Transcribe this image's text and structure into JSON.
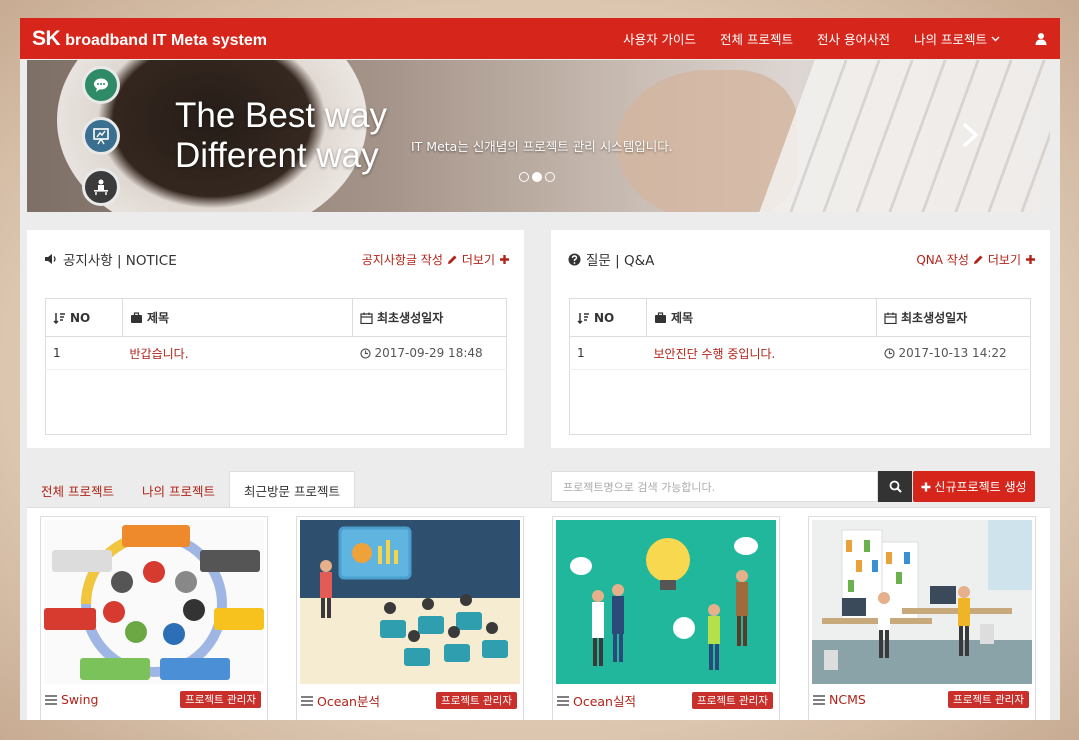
{
  "navbar": {
    "logo_sk": "SK",
    "logo_rest": "broadband IT Meta system",
    "menu": [
      "사용자 가이드",
      "전체 프로젝트",
      "전사 용어사전",
      "나의 프로젝트"
    ],
    "user_icon": "user-icon",
    "color": "#d6261b"
  },
  "carousel": {
    "headline_line1": "The Best way",
    "headline_line2": "Different way",
    "caption": "IT Meta는 신개념의 프로젝트 관리 시스템입니다.",
    "dots_count": 3,
    "active_dot": 2,
    "side_icons": [
      "chat-icon",
      "presentation-icon",
      "meeting-icon"
    ]
  },
  "notice": {
    "title": "공지사항 | NOTICE",
    "write_link": "공지사항글 작성",
    "more_link": "더보기",
    "columns": [
      "NO",
      "제목",
      "최초생성일자"
    ],
    "rows": [
      {
        "no": "1",
        "title": "반갑습니다.",
        "date": "2017-09-29 18:48"
      }
    ]
  },
  "qna": {
    "title": "질문 | Q&A",
    "write_link": "QNA 작성",
    "more_link": "더보기",
    "columns": [
      "NO",
      "제목",
      "최초생성일자"
    ],
    "rows": [
      {
        "no": "1",
        "title": "보안진단 수행 중입니다.",
        "date": "2017-10-13 14:22"
      }
    ]
  },
  "tabs": {
    "items": [
      "전체 프로젝트",
      "나의 프로젝트",
      "최근방문 프로젝트"
    ],
    "active": 2
  },
  "search": {
    "placeholder": "프로젝트명으로 검색 가능합니다.",
    "new_project_label": "신규프로젝트 생성"
  },
  "projects": [
    {
      "name": "Swing",
      "role": "프로젝트 관리자"
    },
    {
      "name": "Ocean분석",
      "role": "프로젝트 관리자"
    },
    {
      "name": "Ocean실적",
      "role": "프로젝트 관리자"
    },
    {
      "name": "NCMS",
      "role": "프로젝트 관리자"
    }
  ],
  "colors": {
    "accent": "#d6261b",
    "link": "#b02318",
    "badge": "#c9302c"
  }
}
